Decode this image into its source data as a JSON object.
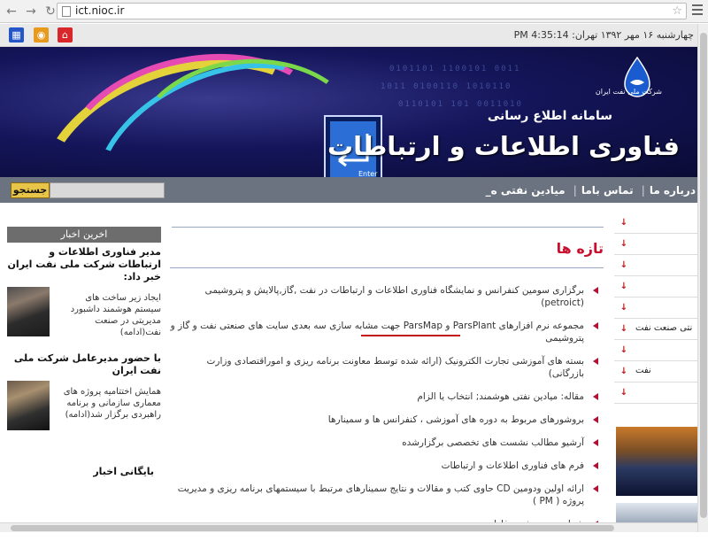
{
  "browser": {
    "url": "ict.nioc.ir"
  },
  "topbar": {
    "date_time": "چهارشنبه ۱۶ مهر ۱۳۹۲      تهران: 4:35:14 PM"
  },
  "banner": {
    "title_small": "سامانه اطلاع رسانی",
    "title_big": "فناوری اطلاعات و ارتباطات",
    "logo_caption": "شرکت ملی نفت ایران",
    "enter_label": "Enter"
  },
  "menu": {
    "search_label": "جستجو",
    "items": [
      "درباره ما",
      "تماس باما",
      "میادین نفتی ه_"
    ]
  },
  "left": {
    "header": "اخرین اخبار",
    "news": [
      {
        "title": "مدیر فناوری اطلاعات و ارتباطات شرکت ملی نفت ایران خبر داد:",
        "body": "ایجاد زیر ساخت های سیستم هوشمند داشبورد مدیریتی در صنعت نفت(ادامه)"
      },
      {
        "title": "با حضور مدیرعامل شرکت ملی نفت ایران",
        "body": "همایش اختتامیه پروژه های معماری سازمانی و برنامه راهبردی برگزار شد(ادامه)"
      }
    ],
    "archive": "بایگانی اخبار"
  },
  "main": {
    "section_title": "تازه ها",
    "items": [
      "برگزاری سومین کنفرانس و نمایشگاه فناوری اطلاعات و ارتباطات در نفت ,گاز,پالایش و پتروشیمی (petroict)",
      "مجموعه نرم افزارهای ParsPlant و ParsMap جهت مشابه سازی سه بعدی سایت های صنعتی نفت و گاز و پتروشیمی",
      "بسته های آموزشی تجارت الکترونیک (ارائه شده توسط معاونت برنامه ریزی و اموراقتصادی وزارت بازرگانی)",
      "مقاله: میادین نفتی هوشمند; انتخاب یا الزام",
      "بروشورهای مربوط به دوره های آموزشی ، کنفرانس ها و سمینارها",
      "آرشیو مطالب نشست های تخصصی برگزارشده",
      "فرم های فناوری اطلاعات و ارتباطات",
      "ارائه اولین ودومین CD حاوی کتب و مقالات و نتایج سمینارهای مرتبط با سیستمهای برنامه ریزی و مدیریت پروژه ( PM )",
      "شماره جدید نشریه فاوا"
    ]
  },
  "right": {
    "rows": [
      "",
      "",
      "",
      "",
      "",
      "نتی صنعت نفت",
      "",
      "نفت",
      "",
      ""
    ]
  },
  "colors": {
    "accent_red": "#c8102e",
    "menu_bar": "#6c7380",
    "banner_bg": "#14155a"
  }
}
